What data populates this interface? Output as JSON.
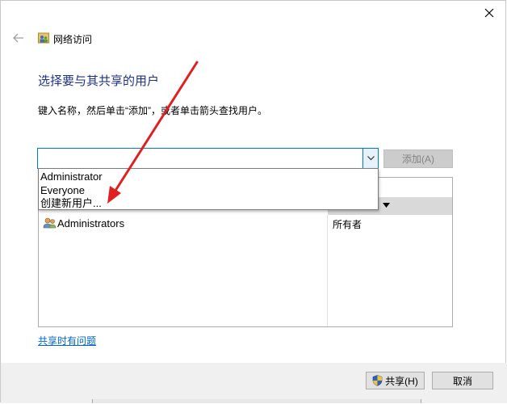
{
  "window": {
    "title": "网络访问",
    "heading": "选择要与其共享的用户",
    "instruction": "键入名称，然后单击“添加”，或者单击箭头查找用户。"
  },
  "combo": {
    "value": "",
    "add_label": "添加(A)"
  },
  "dropdown": {
    "items": [
      "Administrator",
      "Everyone",
      "创建新用户..."
    ]
  },
  "list": {
    "rows": [
      {
        "name": "Administrators",
        "permission": "所有者"
      }
    ]
  },
  "help_link": "共享时有问题",
  "footer": {
    "share_label": "共享(H)",
    "cancel_label": "取消"
  },
  "colors": {
    "heading": "#1e3287",
    "accent": "#0078d7",
    "annotation_arrow": "#e02020"
  }
}
